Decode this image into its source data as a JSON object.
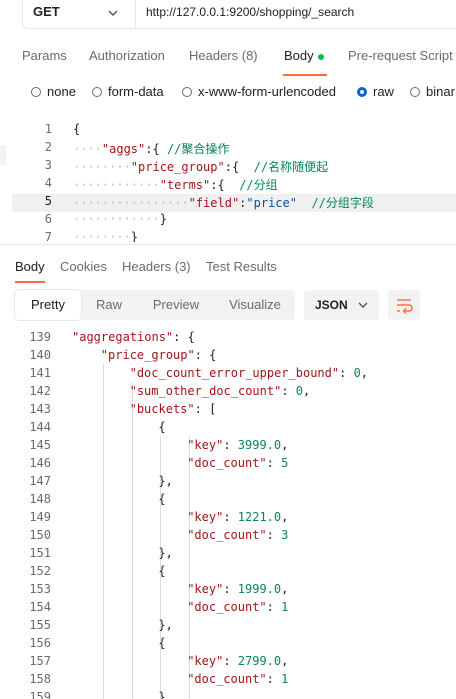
{
  "request": {
    "method": "GET",
    "url": "http://127.0.0.1:9200/shopping/_search"
  },
  "request_tabs": [
    "Params",
    "Authorization",
    "Headers (8)",
    "Body",
    "Pre-request Script"
  ],
  "body_types": [
    "none",
    "form-data",
    "x-www-form-urlencoded",
    "raw",
    "binar"
  ],
  "selected_body_type": "raw",
  "editor": {
    "line_numbers": [
      "1",
      "2",
      "3",
      "4",
      "5",
      "6",
      "7"
    ],
    "lines": [
      [
        {
          "t": "{",
          "c": "p"
        }
      ],
      [
        {
          "t": "\"aggs\"",
          "c": "k"
        },
        {
          "t": ":{ ",
          "c": "p"
        },
        {
          "t": "//聚合操作",
          "c": "c"
        }
      ],
      [
        {
          "t": "\"price_group\"",
          "c": "k"
        },
        {
          "t": ":{  ",
          "c": "p"
        },
        {
          "t": "//名称随便起",
          "c": "c"
        }
      ],
      [
        {
          "t": "\"terms\"",
          "c": "k"
        },
        {
          "t": ":{  ",
          "c": "p"
        },
        {
          "t": "//分组",
          "c": "c"
        }
      ],
      [
        {
          "t": "\"field\"",
          "c": "k"
        },
        {
          "t": ":",
          "c": "p"
        },
        {
          "t": "\"price\"",
          "c": "s"
        },
        {
          "t": "  ",
          "c": "p"
        },
        {
          "t": "//分组字段",
          "c": "c"
        }
      ],
      [
        {
          "t": "}",
          "c": "p"
        }
      ],
      [
        {
          "t": "}",
          "c": "p"
        }
      ]
    ]
  },
  "response_tabs": [
    "Body",
    "Cookies",
    "Headers (3)",
    "Test Results"
  ],
  "view_modes": [
    "Pretty",
    "Raw",
    "Preview",
    "Visualize"
  ],
  "format": "JSON",
  "response": {
    "line_numbers": [
      "139",
      "140",
      "141",
      "142",
      "143",
      "144",
      "145",
      "146",
      "147",
      "148",
      "149",
      "150",
      "151",
      "152",
      "153",
      "154",
      "155",
      "156",
      "157",
      "158",
      "159"
    ],
    "lines": [
      [
        {
          "t": "\"aggregations\"",
          "c": "k"
        },
        {
          "t": ": {",
          "c": "p"
        }
      ],
      [
        {
          "t": "\"price_group\"",
          "c": "k"
        },
        {
          "t": ": {",
          "c": "p"
        }
      ],
      [
        {
          "t": "\"doc_count_error_upper_bound\"",
          "c": "k"
        },
        {
          "t": ": ",
          "c": "p"
        },
        {
          "t": "0",
          "c": "c"
        },
        {
          "t": ",",
          "c": "p"
        }
      ],
      [
        {
          "t": "\"sum_other_doc_count\"",
          "c": "k"
        },
        {
          "t": ": ",
          "c": "p"
        },
        {
          "t": "0",
          "c": "c"
        },
        {
          "t": ",",
          "c": "p"
        }
      ],
      [
        {
          "t": "\"buckets\"",
          "c": "k"
        },
        {
          "t": ": [",
          "c": "p"
        }
      ],
      [
        {
          "t": "{",
          "c": "p"
        }
      ],
      [
        {
          "t": "\"key\"",
          "c": "k"
        },
        {
          "t": ": ",
          "c": "p"
        },
        {
          "t": "3999.0",
          "c": "c"
        },
        {
          "t": ",",
          "c": "p"
        }
      ],
      [
        {
          "t": "\"doc_count\"",
          "c": "k"
        },
        {
          "t": ": ",
          "c": "p"
        },
        {
          "t": "5",
          "c": "c"
        }
      ],
      [
        {
          "t": "},",
          "c": "p"
        }
      ],
      [
        {
          "t": "{",
          "c": "p"
        }
      ],
      [
        {
          "t": "\"key\"",
          "c": "k"
        },
        {
          "t": ": ",
          "c": "p"
        },
        {
          "t": "1221.0",
          "c": "c"
        },
        {
          "t": ",",
          "c": "p"
        }
      ],
      [
        {
          "t": "\"doc_count\"",
          "c": "k"
        },
        {
          "t": ": ",
          "c": "p"
        },
        {
          "t": "3",
          "c": "c"
        }
      ],
      [
        {
          "t": "},",
          "c": "p"
        }
      ],
      [
        {
          "t": "{",
          "c": "p"
        }
      ],
      [
        {
          "t": "\"key\"",
          "c": "k"
        },
        {
          "t": ": ",
          "c": "p"
        },
        {
          "t": "1999.0",
          "c": "c"
        },
        {
          "t": ",",
          "c": "p"
        }
      ],
      [
        {
          "t": "\"doc_count\"",
          "c": "k"
        },
        {
          "t": ": ",
          "c": "p"
        },
        {
          "t": "1",
          "c": "c"
        }
      ],
      [
        {
          "t": "},",
          "c": "p"
        }
      ],
      [
        {
          "t": "{",
          "c": "p"
        }
      ],
      [
        {
          "t": "\"key\"",
          "c": "k"
        },
        {
          "t": ": ",
          "c": "p"
        },
        {
          "t": "2799.0",
          "c": "c"
        },
        {
          "t": ",",
          "c": "p"
        }
      ],
      [
        {
          "t": "\"doc_count\"",
          "c": "k"
        },
        {
          "t": ": ",
          "c": "p"
        },
        {
          "t": "1",
          "c": "c"
        }
      ],
      [
        {
          "t": "}",
          "c": "p"
        }
      ]
    ]
  },
  "colors": {
    "accent": "#ff6c37",
    "active_dot": "#0cbb52",
    "radio_selected": "#0265d2",
    "json_key": "#a31515",
    "json_number": "#098658",
    "json_string": "#0451a5"
  },
  "icons": {
    "method_dropdown": "chevron-down-icon",
    "format_dropdown": "chevron-down-icon",
    "wrap": "wrap-lines-icon"
  }
}
